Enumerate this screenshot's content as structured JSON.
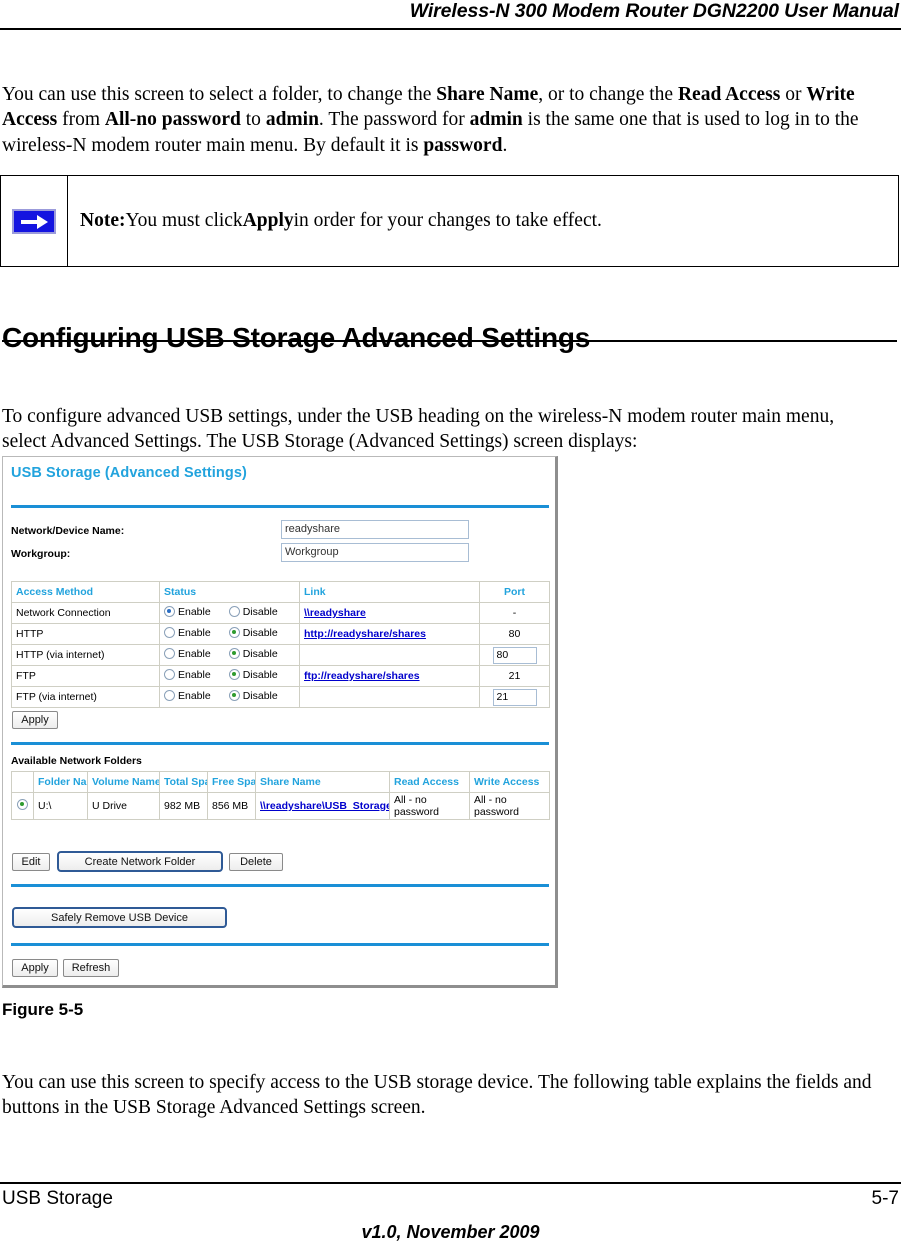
{
  "header": {
    "title": "Wireless-N 300 Modem Router DGN2200 User Manual"
  },
  "intro_paragraph": {
    "segments": [
      {
        "t": "You can use this screen to select a folder, to change the ",
        "b": false
      },
      {
        "t": "Share Name",
        "b": true
      },
      {
        "t": ", or to change the ",
        "b": false
      },
      {
        "t": "Read Access",
        "b": true
      },
      {
        "t": " or ",
        "b": false
      },
      {
        "t": "Write Access",
        "b": true
      },
      {
        "t": " from ",
        "b": false
      },
      {
        "t": "All-no password",
        "b": true
      },
      {
        "t": " to ",
        "b": false
      },
      {
        "t": "admin",
        "b": true
      },
      {
        "t": ". The password for ",
        "b": false
      },
      {
        "t": "admin",
        "b": true
      },
      {
        "t": " is the same one that is used to log in to the wireless-N modem router main menu. By default it is ",
        "b": false
      },
      {
        "t": "password",
        "b": true
      },
      {
        "t": ".",
        "b": false
      }
    ]
  },
  "note": {
    "icon": "blue-arrow-icon",
    "segments": [
      {
        "t": "Note:",
        "b": true
      },
      {
        "t": " You must click ",
        "b": false
      },
      {
        "t": "Apply",
        "b": true
      },
      {
        "t": " in order for your changes to take effect.",
        "b": false
      }
    ]
  },
  "section": {
    "heading": "Configuring USB Storage Advanced Settings"
  },
  "lead_paragraph": {
    "text": "To configure advanced USB settings, under the USB heading on the wireless-N modem router main menu, select Advanced Settings. The USB Storage (Advanced Settings) screen displays:"
  },
  "screenshot": {
    "title": "USB Storage (Advanced Settings)",
    "accent_color": "#22a3dd",
    "fields": [
      {
        "label": "Network/Device Name:",
        "value": "readyshare"
      },
      {
        "label": "Workgroup:",
        "value": "Workgroup"
      }
    ],
    "access_table": {
      "columns": [
        "Access Method",
        "Status",
        "Link",
        "Port"
      ],
      "rows": [
        {
          "method": "Network Connection",
          "enable_label": "Enable",
          "disable_label": "Disable",
          "selected": "enable",
          "link": "\\\\readyshare",
          "port": "-",
          "port_is_input": false
        },
        {
          "method": "HTTP",
          "enable_label": "Enable",
          "disable_label": "Disable",
          "selected": "disable",
          "link": "http://readyshare/shares",
          "port": "80",
          "port_is_input": false
        },
        {
          "method": "HTTP (via internet)",
          "enable_label": "Enable",
          "disable_label": "Disable",
          "selected": "disable",
          "link": "",
          "port": "80",
          "port_is_input": true
        },
        {
          "method": "FTP",
          "enable_label": "Enable",
          "disable_label": "Disable",
          "selected": "disable",
          "link": "ftp://readyshare/shares",
          "port": "21",
          "port_is_input": false
        },
        {
          "method": "FTP (via internet)",
          "enable_label": "Enable",
          "disable_label": "Disable",
          "selected": "disable",
          "link": "",
          "port": "21",
          "port_is_input": true
        }
      ]
    },
    "apply_top_label": "Apply",
    "folders_section_label": "Available Network Folders",
    "folders_table": {
      "columns": [
        "",
        "Folder Name",
        "Volume Name",
        "Total Space",
        "Free Space",
        "Share Name",
        "Read Access",
        "Write Access"
      ],
      "rows": [
        {
          "selected": true,
          "folder_name": "U:\\",
          "volume_name": "U Drive",
          "total_space": "982 MB",
          "free_space": "856 MB",
          "share_name": "\\\\readyshare\\USB_Storage",
          "read_access": "All - no password",
          "write_access": "All - no password"
        }
      ]
    },
    "folder_buttons": [
      "Edit",
      "Create Network Folder",
      "Delete"
    ],
    "safely_remove_label": "Safely Remove USB Device",
    "bottom_buttons": [
      "Apply",
      "Refresh"
    ]
  },
  "figure": {
    "caption": "Figure 5-5"
  },
  "outro_paragraph": {
    "text": "You can use this screen to specify access to the USB storage device. The following table explains the fields and buttons in the USB Storage Advanced Settings screen."
  },
  "footer": {
    "left": "USB Storage",
    "right": "5-7",
    "version": "v1.0, November 2009"
  }
}
